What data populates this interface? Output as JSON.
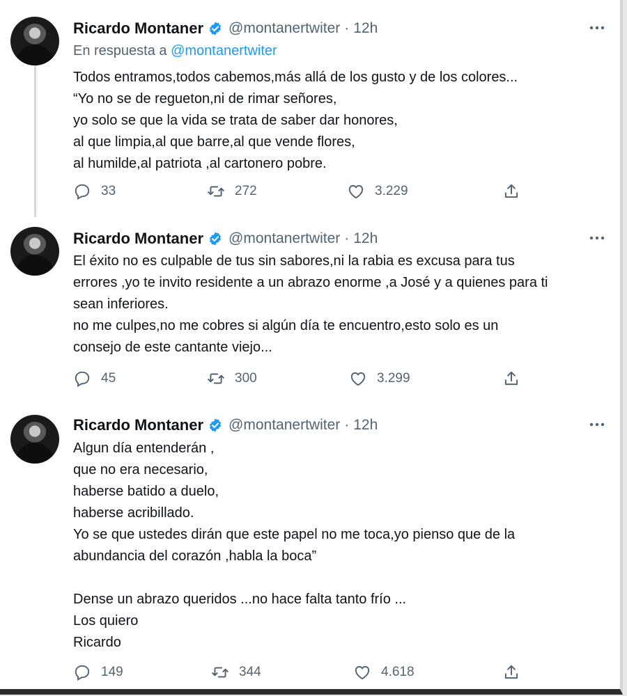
{
  "tweets": [
    {
      "author_name": "Ricardo Montaner",
      "handle": "@montanertwiter",
      "separator": "·",
      "time": "12h",
      "reply_prefix": "En respuesta a ",
      "reply_handle": "@montanertwiter",
      "lines": [
        "Todos entramos,todos cabemos,más allá de los gusto y de los colores...",
        "“Yo no se de regueton,ni de rimar señores,",
        "yo solo se que la vida se trata de saber dar honores,",
        "al que limpia,al que barre,al que vende flores,",
        "al humilde,al patriota ,al cartonero pobre."
      ],
      "replies": "33",
      "retweets": "272",
      "likes": "3.229"
    },
    {
      "author_name": "Ricardo Montaner",
      "handle": "@montanertwiter",
      "separator": "·",
      "time": "12h",
      "lines": [
        "El éxito no es culpable de tus sin sabores,ni la rabia es excusa para tus",
        "errores ,yo te invito residente a un abrazo enorme ,a José y a quienes para ti",
        "sean inferiores.",
        "no me culpes,no me cobres si algún día te encuentro,esto solo es un",
        "consejo de este cantante viejo..."
      ],
      "replies": "45",
      "retweets": "300",
      "likes": "3.299"
    },
    {
      "author_name": "Ricardo Montaner",
      "handle": "@montanertwiter",
      "separator": "·",
      "time": "12h",
      "lines": [
        "Algun día entenderán ,",
        "que no era necesario,",
        "haberse batido a duelo,",
        "haberse acribillado.",
        "Yo se que ustedes dirán que este papel no me toca,yo pienso que de la",
        "abundancia del corazón ,habla la boca”",
        "",
        "Dense un abrazo queridos ...no hace falta tanto frío ...",
        "Los quiero",
        "Ricardo"
      ],
      "replies": "149",
      "retweets": "344",
      "likes": "4.618"
    }
  ],
  "icons": {
    "reply": "reply-icon",
    "retweet": "retweet-icon",
    "like": "heart-icon",
    "share": "share-icon",
    "more": "more-icon",
    "verified": "verified-badge-icon"
  },
  "colors": {
    "verified": "#1d9bf0",
    "secondary_text": "#536471",
    "primary_text": "#0f1419",
    "link": "#1d9bf0"
  }
}
